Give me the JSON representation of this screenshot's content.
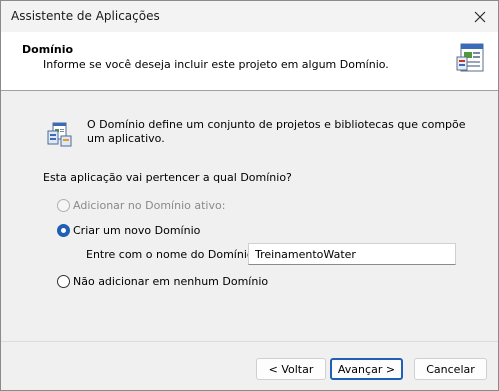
{
  "window": {
    "title": "Assistente de Aplicações"
  },
  "header": {
    "title": "Domínio",
    "subtitle": "Informe se você deseja incluir este projeto em algum Domínio."
  },
  "body": {
    "info_text": "O Domínio define um conjunto de projetos e bibliotecas que compõe um aplicativo.",
    "question": "Esta aplicação vai pertencer a qual Domínio?",
    "options": {
      "add_active": "Adicionar no Domínio ativo:",
      "create_new": "Criar um novo Domínio",
      "none": "Não adicionar em nenhum Domínio"
    },
    "selected_option": "create_new",
    "domain_name_label": "Entre com o nome do Domínio:",
    "domain_name_value": "TreinamentoWater"
  },
  "buttons": {
    "back": "< Voltar",
    "next": "Avançar >",
    "cancel": "Cancelar"
  },
  "icons": {
    "close": "close-icon",
    "header": "wizard-document-icon",
    "info": "domain-info-icon"
  }
}
